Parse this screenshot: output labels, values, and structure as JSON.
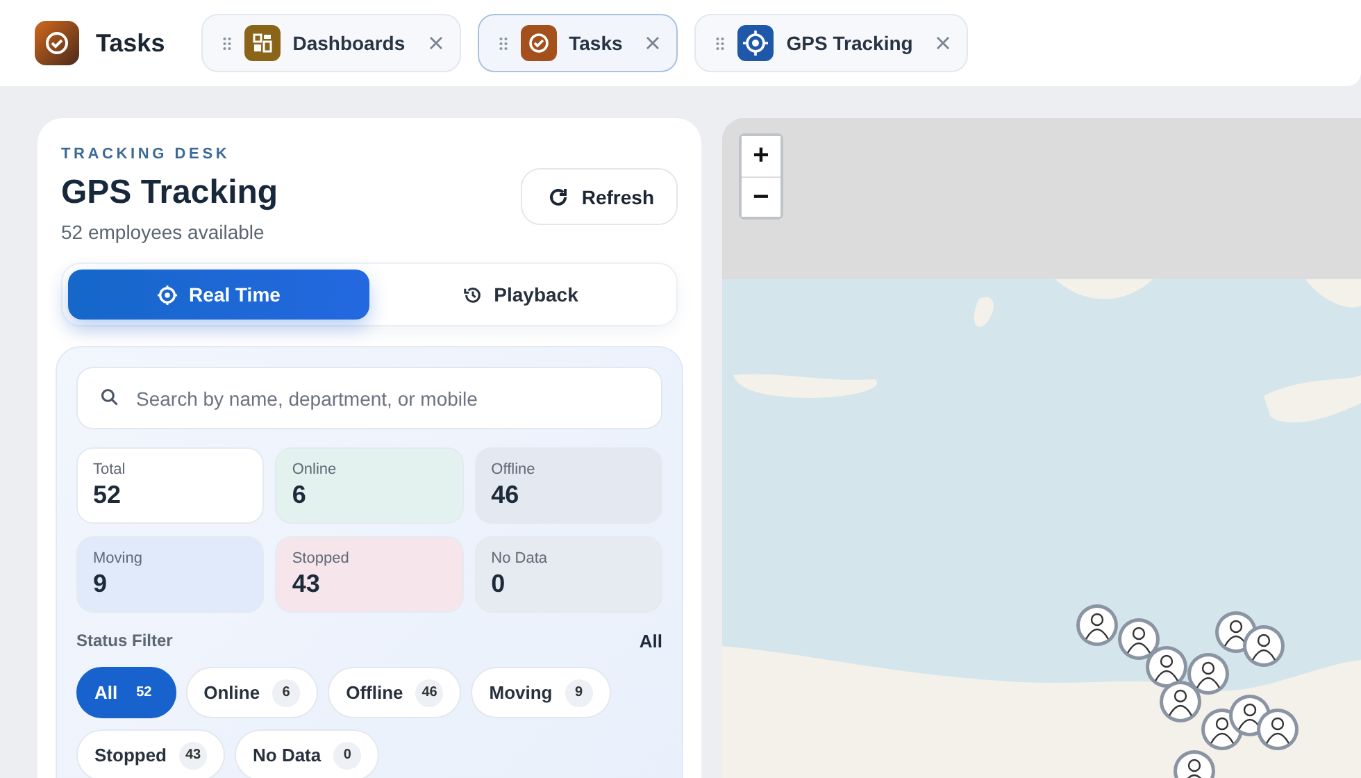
{
  "app": {
    "title": "Tasks"
  },
  "tabs": [
    {
      "label": "Dashboards",
      "kind": "dashboard",
      "selected": false
    },
    {
      "label": "Tasks",
      "kind": "tasks",
      "selected": true
    },
    {
      "label": "GPS Tracking",
      "kind": "gps",
      "selected": false
    }
  ],
  "panel": {
    "eyebrow": "TRACKING DESK",
    "title": "GPS Tracking",
    "subtitle": "52 employees available",
    "refresh_button": "Refresh",
    "modes": [
      {
        "label": "Real Time",
        "kind": "realtime",
        "selected": true
      },
      {
        "label": "Playback",
        "kind": "playback",
        "selected": false
      }
    ],
    "search": {
      "placeholder": "Search by name, department, or mobile"
    },
    "stats": [
      {
        "label": "Total",
        "value": "52",
        "kind": "total"
      },
      {
        "label": "Online",
        "value": "6",
        "kind": "online"
      },
      {
        "label": "Offline",
        "value": "46",
        "kind": "offline"
      },
      {
        "label": "Moving",
        "value": "9",
        "kind": "moving"
      },
      {
        "label": "Stopped",
        "value": "43",
        "kind": "stopped"
      },
      {
        "label": "No Data",
        "value": "0",
        "kind": "nodata"
      }
    ],
    "status_filter": {
      "title": "Status Filter",
      "current": "All"
    },
    "filters": [
      {
        "label": "All",
        "count": "52",
        "selected": true
      },
      {
        "label": "Online",
        "count": "6",
        "selected": false
      },
      {
        "label": "Offline",
        "count": "46",
        "selected": false
      },
      {
        "label": "Moving",
        "count": "9",
        "selected": false
      },
      {
        "label": "Stopped",
        "count": "43",
        "selected": false
      },
      {
        "label": "No Data",
        "count": "0",
        "selected": false
      }
    ]
  },
  "map": {
    "zoom_in": "+",
    "zoom_out": "−"
  }
}
